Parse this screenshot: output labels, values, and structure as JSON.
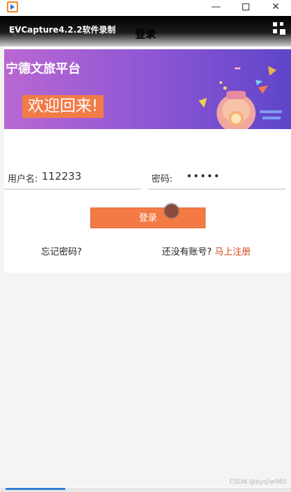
{
  "window": {
    "app_icon": "evcapture-logo-icon",
    "minimize_glyph": "—",
    "close_glyph": "✕"
  },
  "recorder_overlay": "EVCapture4.2.2软件录制",
  "appbar": {
    "title": "登录",
    "back_icon": "back-arrow-icon",
    "menu_icon": "grid-menu-icon"
  },
  "banner": {
    "title": "宁德文旅平台",
    "welcome": "欢迎回来!"
  },
  "form": {
    "username_label": "用户名:",
    "username_value": "112233",
    "password_label": "密码:",
    "password_value": "•••••",
    "login_button": "登录",
    "forgot_password": "忘记密码?",
    "no_account": "还没有账号?",
    "register_link": "马上注册"
  },
  "watermark": "CSDN @bysjlw985",
  "colors": {
    "accent": "#f47a45",
    "link": "#d24a1c",
    "banner_start": "#b968d2",
    "banner_end": "#5e45c9"
  }
}
